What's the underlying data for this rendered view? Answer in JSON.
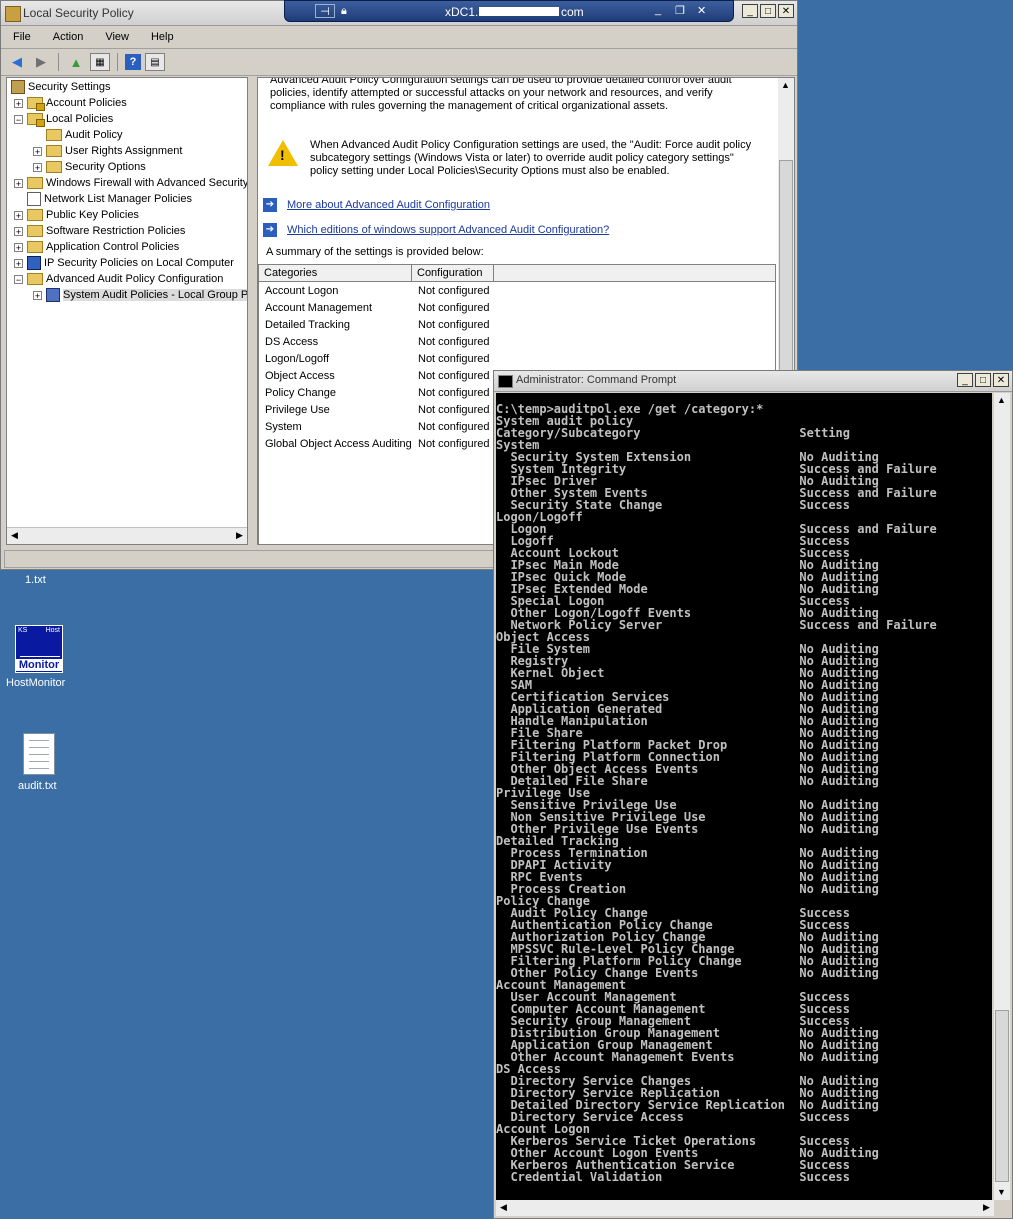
{
  "lsp": {
    "title": "Local Security Policy",
    "menu": [
      "File",
      "Action",
      "View",
      "Help"
    ],
    "tree": [
      {
        "label": "Security Settings"
      },
      {
        "label": "Account Policies"
      },
      {
        "label": "Local Policies"
      },
      {
        "label": "Audit Policy"
      },
      {
        "label": "User Rights Assignment"
      },
      {
        "label": "Security Options"
      },
      {
        "label": "Windows Firewall with Advanced Security"
      },
      {
        "label": "Network List Manager Policies"
      },
      {
        "label": "Public Key Policies"
      },
      {
        "label": "Software Restriction Policies"
      },
      {
        "label": "Application Control Policies"
      },
      {
        "label": "IP Security Policies on Local Computer"
      },
      {
        "label": "Advanced Audit Policy Configuration"
      },
      {
        "label": "System Audit Policies - Local Group Po"
      }
    ],
    "intro_text": "Advanced Audit Policy Configuration settings can be used to provide detailed control over audit policies, identify attempted or successful attacks on your network and resources, and verify compliance with rules governing the management of critical organizational assets.",
    "warning_text": "When Advanced Audit Policy Configuration settings are used, the \"Audit: Force audit policy subcategory settings (Windows Vista or later) to override audit policy category settings\" policy setting under Local Policies\\Security Options must also be enabled.",
    "link1": "More about Advanced Audit Configuration",
    "link2": "Which editions of windows support Advanced Audit Configuration?",
    "summary": "A summary of the settings is provided below:",
    "columns": [
      "Categories",
      "Configuration"
    ],
    "rows": [
      {
        "category": "Account Logon",
        "config": "Not configured"
      },
      {
        "category": "Account Management",
        "config": "Not configured"
      },
      {
        "category": "Detailed Tracking",
        "config": "Not configured"
      },
      {
        "category": "DS Access",
        "config": "Not configured"
      },
      {
        "category": "Logon/Logoff",
        "config": "Not configured"
      },
      {
        "category": "Object Access",
        "config": "Not configured"
      },
      {
        "category": "Policy Change",
        "config": "Not configured"
      },
      {
        "category": "Privilege Use",
        "config": "Not configured"
      },
      {
        "category": "System",
        "config": "Not configured"
      },
      {
        "category": "Global Object Access Auditing",
        "config": "Not configured"
      }
    ]
  },
  "rdp": {
    "host_prefix": "xDC1.",
    "host_suffix": "com"
  },
  "desktop": {
    "file1": "1.txt",
    "hostmonitor": "HostMonitor",
    "audit": "audit.txt",
    "hm_ks": "KS",
    "hm_host": "Host",
    "hm_monitor": "Monitor"
  },
  "cmd": {
    "title": "Administrator: Command Prompt",
    "lines": [
      "C:\\temp>auditpol.exe /get /category:*",
      "System audit policy",
      "Category/Subcategory                      Setting",
      "System",
      "  Security System Extension               No Auditing",
      "  System Integrity                        Success and Failure",
      "  IPsec Driver                            No Auditing",
      "  Other System Events                     Success and Failure",
      "  Security State Change                   Success",
      "Logon/Logoff",
      "  Logon                                   Success and Failure",
      "  Logoff                                  Success",
      "  Account Lockout                         Success",
      "  IPsec Main Mode                         No Auditing",
      "  IPsec Quick Mode                        No Auditing",
      "  IPsec Extended Mode                     No Auditing",
      "  Special Logon                           Success",
      "  Other Logon/Logoff Events               No Auditing",
      "  Network Policy Server                   Success and Failure",
      "Object Access",
      "  File System                             No Auditing",
      "  Registry                                No Auditing",
      "  Kernel Object                           No Auditing",
      "  SAM                                     No Auditing",
      "  Certification Services                  No Auditing",
      "  Application Generated                   No Auditing",
      "  Handle Manipulation                     No Auditing",
      "  File Share                              No Auditing",
      "  Filtering Platform Packet Drop          No Auditing",
      "  Filtering Platform Connection           No Auditing",
      "  Other Object Access Events              No Auditing",
      "  Detailed File Share                     No Auditing",
      "Privilege Use",
      "  Sensitive Privilege Use                 No Auditing",
      "  Non Sensitive Privilege Use             No Auditing",
      "  Other Privilege Use Events              No Auditing",
      "Detailed Tracking",
      "  Process Termination                     No Auditing",
      "  DPAPI Activity                          No Auditing",
      "  RPC Events                              No Auditing",
      "  Process Creation                        No Auditing",
      "Policy Change",
      "  Audit Policy Change                     Success",
      "  Authentication Policy Change            Success",
      "  Authorization Policy Change             No Auditing",
      "  MPSSVC Rule-Level Policy Change         No Auditing",
      "  Filtering Platform Policy Change        No Auditing",
      "  Other Policy Change Events              No Auditing",
      "Account Management",
      "  User Account Management                 Success",
      "  Computer Account Management             Success",
      "  Security Group Management               Success",
      "  Distribution Group Management           No Auditing",
      "  Application Group Management            No Auditing",
      "  Other Account Management Events         No Auditing",
      "DS Access",
      "  Directory Service Changes               No Auditing",
      "  Directory Service Replication           No Auditing",
      "  Detailed Directory Service Replication  No Auditing",
      "  Directory Service Access                Success",
      "Account Logon",
      "  Kerberos Service Ticket Operations      Success",
      "  Other Account Logon Events              No Auditing",
      "  Kerberos Authentication Service         Success",
      "  Credential Validation                   Success"
    ]
  }
}
